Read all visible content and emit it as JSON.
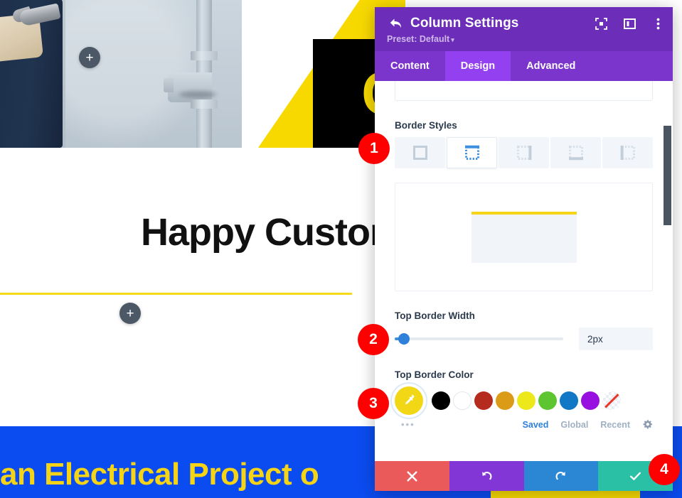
{
  "canvas": {
    "headline": "Happy Custom",
    "cta_text": "an Electrical Project o",
    "logo_glyph": "C",
    "add_module_top_label": "+",
    "add_module_mid_label": "+",
    "colors": {
      "yellow": "#f7d900",
      "blue_band": "#0b4cf0",
      "cta_yellow": "#f5d417",
      "rule_yellow": "#f5db15",
      "black_block": "#000000",
      "plus_button": "#4c5866"
    }
  },
  "modal": {
    "header": {
      "title": "Column Settings",
      "back_icon": "back-arrow-icon",
      "preset_label": "Preset: Default",
      "preset_caret": "▾",
      "icons": [
        {
          "name": "focus-mode-icon",
          "label": "Focus"
        },
        {
          "name": "layout-view-icon",
          "label": "View Layout"
        },
        {
          "name": "more-options-icon",
          "label": "More"
        }
      ],
      "bg_color": "#6c2eb9"
    },
    "tabs": [
      {
        "label": "Content",
        "active": false
      },
      {
        "label": "Design",
        "active": true
      },
      {
        "label": "Advanced",
        "active": false
      }
    ],
    "body": {
      "border_styles": {
        "label": "Border Styles",
        "options": [
          {
            "name": "border-all-icon",
            "active": false
          },
          {
            "name": "border-top-icon",
            "active": true
          },
          {
            "name": "border-right-icon",
            "active": false
          },
          {
            "name": "border-bottom-icon",
            "active": false
          },
          {
            "name": "border-left-icon",
            "active": false
          }
        ]
      },
      "preview": {
        "border_color": "#f5d417",
        "fill_color": "#f1f4f9"
      },
      "top_border_width": {
        "label": "Top Border Width",
        "value": "2px",
        "slider_percent": 2,
        "accent": "#2e80d8"
      },
      "top_border_color": {
        "label": "Top Border Color",
        "selected": "#f2d717",
        "selected_icon": "eyedropper-icon",
        "more_dots": "•••",
        "swatches": [
          {
            "name": "swatch-black",
            "hex": "#000000"
          },
          {
            "name": "swatch-white",
            "hex": "#ffffff"
          },
          {
            "name": "swatch-dark-red",
            "hex": "#b52b1e"
          },
          {
            "name": "swatch-amber",
            "hex": "#dc9b17"
          },
          {
            "name": "swatch-yellow",
            "hex": "#ece81a"
          },
          {
            "name": "swatch-green",
            "hex": "#5cc52f"
          },
          {
            "name": "swatch-blue",
            "hex": "#1078c4"
          },
          {
            "name": "swatch-purple",
            "hex": "#9810e0"
          },
          {
            "name": "swatch-transparent",
            "hex": "none"
          }
        ],
        "tabs": [
          {
            "label": "Saved",
            "active": true
          },
          {
            "label": "Global",
            "active": false
          },
          {
            "label": "Recent",
            "active": false
          }
        ],
        "settings_icon": "gear-icon"
      }
    },
    "footer": [
      {
        "name": "cancel-button",
        "glyph": "✖",
        "color": "#ea5a5a"
      },
      {
        "name": "undo-button",
        "glyph": "↺",
        "color": "#8236d6"
      },
      {
        "name": "redo-button",
        "glyph": "↻",
        "color": "#2b87d4"
      },
      {
        "name": "save-button",
        "glyph": "✔",
        "color": "#2ac0a5"
      }
    ]
  },
  "badges": [
    {
      "number": "1"
    },
    {
      "number": "2"
    },
    {
      "number": "3"
    },
    {
      "number": "4"
    }
  ]
}
